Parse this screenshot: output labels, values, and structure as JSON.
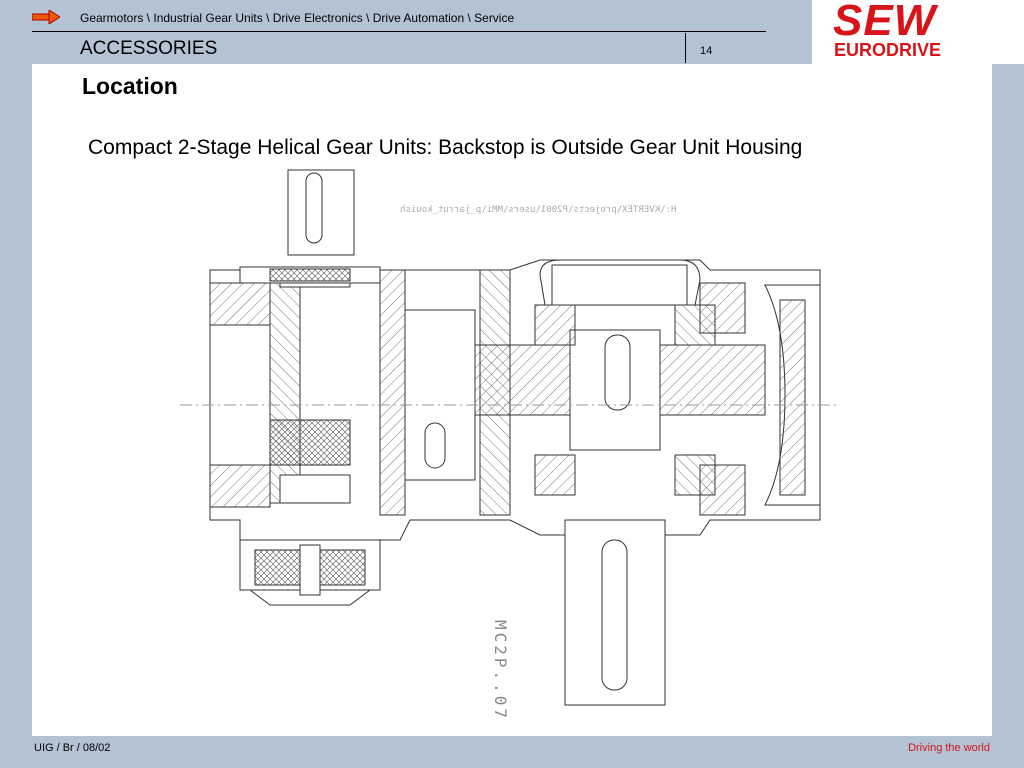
{
  "header": {
    "breadcrumb": "Gearmotors \\ Industrial Gear Units \\ Drive Electronics \\ Drive Automation \\ Service",
    "section": "ACCESSORIES",
    "page_number": "14"
  },
  "logo": {
    "line1": "SEW",
    "line2": "EURODRIVE",
    "color": "#d7141a"
  },
  "content": {
    "heading": "Location",
    "subtitle": "Compact 2-Stage Helical Gear Units: Backstop is Outside Gear Unit Housing",
    "drawing_path_text": "H:\\KVERTEX\\projects\\P2001\\users\\MMi\\p_jarrut_kouish",
    "drawing_code": "MC2P..07"
  },
  "footer": {
    "left": "UIG / Br / 08/02",
    "right": "Driving the world"
  },
  "colors": {
    "background": "#b3c3d3",
    "accent": "#d7141a"
  }
}
